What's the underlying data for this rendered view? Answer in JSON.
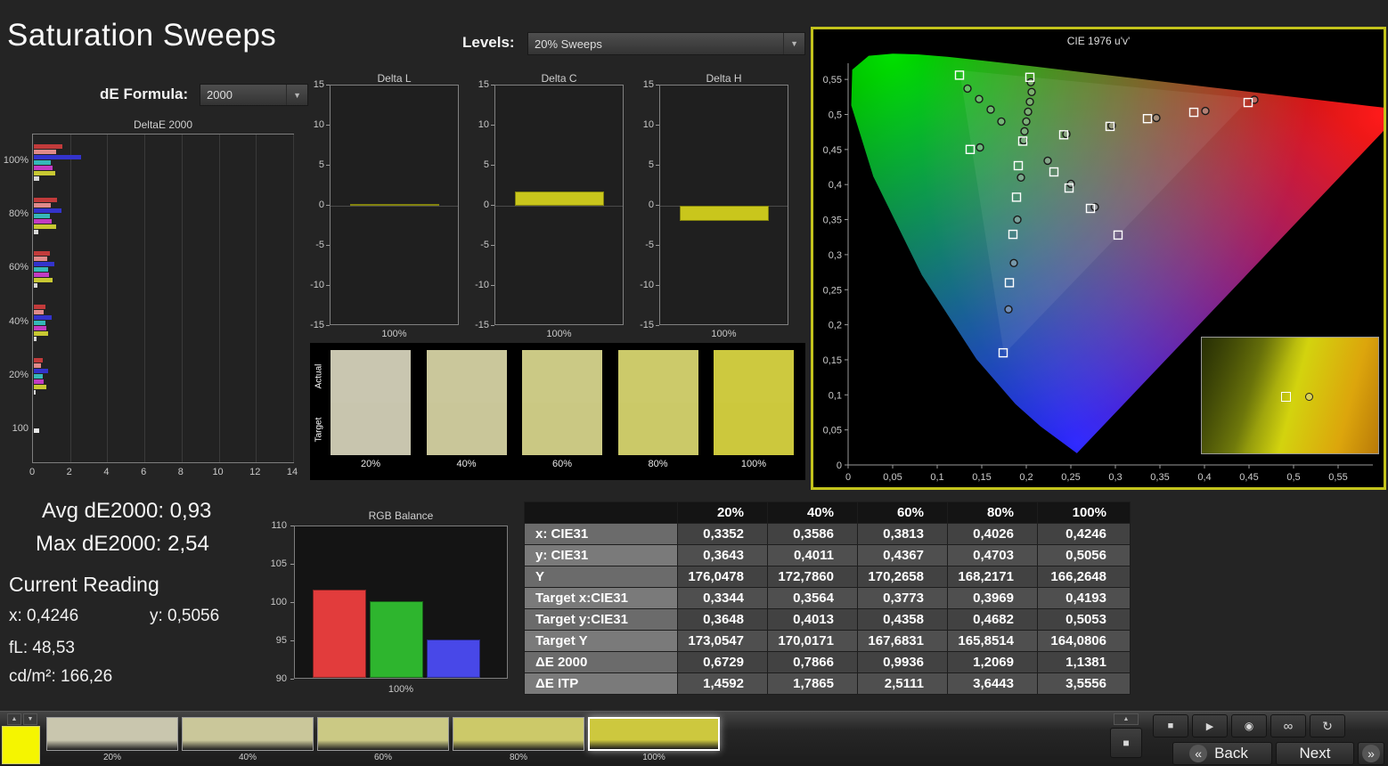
{
  "header": {
    "title": "Saturation Sweeps",
    "de_formula_label": "dE Formula:",
    "de_formula_value": "2000",
    "levels_label": "Levels:",
    "levels_value": "20% Sweeps"
  },
  "glyphs": {
    "dropdown_arrow": "▼"
  },
  "readouts": {
    "avg": "Avg dE2000: 0,93",
    "max": "Max dE2000: 2,54",
    "current_reading": "Current Reading",
    "x": "x: 0,4246",
    "y": "y: 0,5056",
    "fl": "fL: 48,53",
    "cd": "cd/m²: 166,26"
  },
  "chart_data": {
    "deltae": {
      "type": "bar",
      "title": "DeltaE 2000",
      "xlim": [
        0,
        14
      ],
      "xticks": [
        0,
        2,
        4,
        6,
        8,
        10,
        12,
        14
      ],
      "categories": [
        "100%",
        "80%",
        "60%",
        "40%",
        "20%",
        "100"
      ],
      "groups": [
        {
          "label": "100%",
          "bars": [
            [
              "#c23b3b",
              1.55
            ],
            [
              "#e08a8a",
              1.2
            ],
            [
              "#3333cc",
              2.54
            ],
            [
              "#35b8b8",
              0.9
            ],
            [
              "#c23bc2",
              1.0
            ],
            [
              "#c8c832",
              1.14
            ],
            [
              "#d8d8d8",
              0.3
            ]
          ]
        },
        {
          "label": "80%",
          "bars": [
            [
              "#c23b3b",
              1.25
            ],
            [
              "#e08a8a",
              0.9
            ],
            [
              "#3333cc",
              1.5
            ],
            [
              "#35b8b8",
              0.85
            ],
            [
              "#c23bc2",
              0.95
            ],
            [
              "#c8c832",
              1.21
            ],
            [
              "#d8d8d8",
              0.25
            ]
          ]
        },
        {
          "label": "60%",
          "bars": [
            [
              "#c23b3b",
              0.85
            ],
            [
              "#e08a8a",
              0.7
            ],
            [
              "#3333cc",
              1.1
            ],
            [
              "#35b8b8",
              0.75
            ],
            [
              "#c23bc2",
              0.8
            ],
            [
              "#c8c832",
              0.99
            ],
            [
              "#d8d8d8",
              0.2
            ]
          ]
        },
        {
          "label": "40%",
          "bars": [
            [
              "#c23b3b",
              0.6
            ],
            [
              "#e08a8a",
              0.55
            ],
            [
              "#3333cc",
              0.95
            ],
            [
              "#35b8b8",
              0.6
            ],
            [
              "#c23bc2",
              0.65
            ],
            [
              "#c8c832",
              0.79
            ],
            [
              "#d8d8d8",
              0.15
            ]
          ]
        },
        {
          "label": "20%",
          "bars": [
            [
              "#c23b3b",
              0.5
            ],
            [
              "#e08a8a",
              0.4
            ],
            [
              "#3333cc",
              0.75
            ],
            [
              "#35b8b8",
              0.5
            ],
            [
              "#c23bc2",
              0.55
            ],
            [
              "#c8c832",
              0.67
            ],
            [
              "#d8d8d8",
              0.1
            ]
          ]
        },
        {
          "label": "100",
          "bars": [
            [
              "#e8e8e8",
              0.3
            ]
          ]
        }
      ]
    },
    "delta_yticks": [
      15,
      10,
      5,
      0,
      -5,
      -10,
      -15
    ],
    "delta_bars": [
      {
        "title": "Delta L",
        "xlabel": "100%",
        "value": 0.15
      },
      {
        "title": "Delta C",
        "xlabel": "100%",
        "value": 1.8
      },
      {
        "title": "Delta H",
        "xlabel": "100%",
        "value": -1.9
      }
    ],
    "rgb": {
      "type": "bar",
      "title": "RGB Balance",
      "xlabel": "100%",
      "ylim": [
        90,
        110
      ],
      "yticks": [
        110,
        105,
        100,
        95,
        90
      ],
      "bars": [
        {
          "name": "Red",
          "color": "#e23c3c",
          "value": 101.5
        },
        {
          "name": "Green",
          "color": "#2eb52e",
          "value": 100.0
        },
        {
          "name": "Blue",
          "color": "#4848e8",
          "value": 95.0
        }
      ]
    },
    "cie": {
      "type": "scatter",
      "title": "CIE 1976 u'v'",
      "xlim": [
        0,
        0.58
      ],
      "ylim": [
        0,
        0.58
      ],
      "xtick_labels": [
        "0",
        "0,05",
        "0,1",
        "0,15",
        "0,2",
        "0,25",
        "0,3",
        "0,35",
        "0,4",
        "0,45",
        "0,5",
        "0,55"
      ],
      "ytick_labels": [
        "0",
        "0,05",
        "0,1",
        "0,15",
        "0,2",
        "0,25",
        "0,3",
        "0,35",
        "0,4",
        "0,45",
        "0,5",
        "0,55"
      ],
      "targets": [
        [
          0.125,
          0.556
        ],
        [
          0.204,
          0.553
        ],
        [
          0.449,
          0.517
        ],
        [
          0.388,
          0.503
        ],
        [
          0.336,
          0.494
        ],
        [
          0.294,
          0.483
        ],
        [
          0.242,
          0.471
        ],
        [
          0.196,
          0.462
        ],
        [
          0.137,
          0.45
        ],
        [
          0.191,
          0.427
        ],
        [
          0.231,
          0.418
        ],
        [
          0.248,
          0.395
        ],
        [
          0.189,
          0.382
        ],
        [
          0.272,
          0.366
        ],
        [
          0.185,
          0.329
        ],
        [
          0.303,
          0.328
        ],
        [
          0.181,
          0.26
        ],
        [
          0.174,
          0.16
        ]
      ],
      "measured": [
        [
          0.134,
          0.537
        ],
        [
          0.147,
          0.522
        ],
        [
          0.16,
          0.507
        ],
        [
          0.172,
          0.49
        ],
        [
          0.205,
          0.546
        ],
        [
          0.206,
          0.532
        ],
        [
          0.204,
          0.518
        ],
        [
          0.202,
          0.504
        ],
        [
          0.2,
          0.49
        ],
        [
          0.198,
          0.476
        ],
        [
          0.456,
          0.521
        ],
        [
          0.401,
          0.505
        ],
        [
          0.346,
          0.495
        ],
        [
          0.296,
          0.484
        ],
        [
          0.245,
          0.472
        ],
        [
          0.197,
          0.463
        ],
        [
          0.148,
          0.453
        ],
        [
          0.224,
          0.434
        ],
        [
          0.25,
          0.401
        ],
        [
          0.277,
          0.368
        ],
        [
          0.194,
          0.41
        ],
        [
          0.19,
          0.35
        ],
        [
          0.186,
          0.288
        ],
        [
          0.18,
          0.222
        ]
      ],
      "inset": {
        "square": [
          0.45,
          0.47
        ],
        "circle": [
          0.585,
          0.48
        ]
      }
    }
  },
  "swatch_panel": {
    "actual_label": "Actual",
    "target_label": "Target",
    "swatches": [
      {
        "label": "20%",
        "actual": "#c9c6b0",
        "target": "#c8c5ae"
      },
      {
        "label": "40%",
        "actual": "#cac79b",
        "target": "#c9c699"
      },
      {
        "label": "60%",
        "actual": "#cbc985",
        "target": "#cac883"
      },
      {
        "label": "80%",
        "actual": "#ccca6a",
        "target": "#cbc968"
      },
      {
        "label": "100%",
        "actual": "#cdc93f",
        "target": "#ccc83d"
      }
    ]
  },
  "table": {
    "header": [
      "",
      "20%",
      "40%",
      "60%",
      "80%",
      "100%"
    ],
    "rows": [
      {
        "label": "x: CIE31",
        "values": [
          "0,3352",
          "0,3586",
          "0,3813",
          "0,4026",
          "0,4246"
        ]
      },
      {
        "label": "y: CIE31",
        "values": [
          "0,3643",
          "0,4011",
          "0,4367",
          "0,4703",
          "0,5056"
        ]
      },
      {
        "label": "Y",
        "values": [
          "176,0478",
          "172,7860",
          "170,2658",
          "168,2171",
          "166,2648"
        ]
      },
      {
        "label": "Target x:CIE31",
        "values": [
          "0,3344",
          "0,3564",
          "0,3773",
          "0,3969",
          "0,4193"
        ]
      },
      {
        "label": "Target y:CIE31",
        "values": [
          "0,3648",
          "0,4013",
          "0,4358",
          "0,4682",
          "0,5053"
        ]
      },
      {
        "label": "Target Y",
        "values": [
          "173,0547",
          "170,0171",
          "167,6831",
          "165,8514",
          "164,0806"
        ]
      },
      {
        "label": "ΔE 2000",
        "values": [
          "0,6729",
          "0,7866",
          "0,9936",
          "1,2069",
          "1,1381"
        ]
      },
      {
        "label": "ΔE ITP",
        "values": [
          "1,4592",
          "1,7865",
          "2,5111",
          "3,6443",
          "3,5556"
        ]
      }
    ]
  },
  "bottom_bar": {
    "active_swatch_color": "#f5f500",
    "patches": [
      {
        "label": "20%",
        "color": "#c9c6ae",
        "selected": false
      },
      {
        "label": "40%",
        "color": "#cac79a",
        "selected": false
      },
      {
        "label": "60%",
        "color": "#cbc984",
        "selected": false
      },
      {
        "label": "80%",
        "color": "#ccc969",
        "selected": false
      },
      {
        "label": "100%",
        "color": "#cdc83e",
        "selected": true
      }
    ],
    "icons": {
      "up": "▲",
      "down": "▼",
      "stop_square": "■",
      "stop": "■",
      "play": "▶",
      "capture": "◉",
      "loop": "∞",
      "refresh": "↻",
      "prev": "«",
      "next": "»"
    },
    "back_label": "Back",
    "next_label": "Next"
  }
}
